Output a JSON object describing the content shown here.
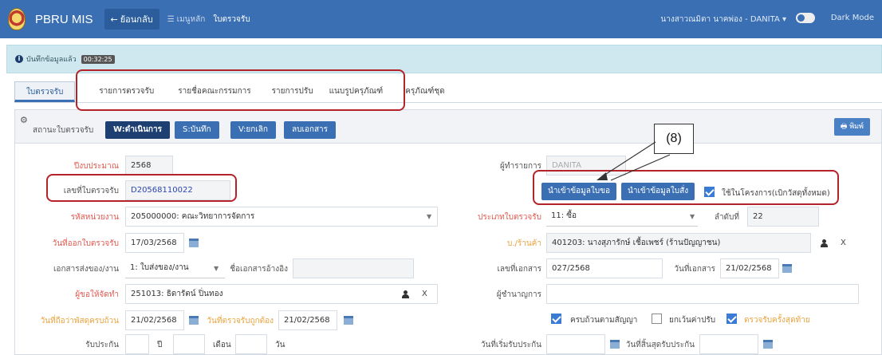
{
  "topbar": {
    "brand": "PBRU MIS",
    "back_label": "ย้อนกลับ",
    "menu_label": "เมนูหลัก",
    "crumb": "ใบตรวจรับ",
    "user": "นางสาวณมิตา นาคพ่อง - DANITA ▾",
    "dark_mode_label": "Dark Mode"
  },
  "alert": {
    "text": "บันทึกข้อมูลแล้ว",
    "time": "00:32:25"
  },
  "tabs": [
    {
      "label": "ใบตรวจรับ"
    },
    {
      "label": "รายการตรวจรับ"
    },
    {
      "label": "รายชื่อคณะกรรมการ"
    },
    {
      "label": "รายการปรับ"
    },
    {
      "label": "แนบรูปครุภัณฑ์"
    },
    {
      "label": "ครุภัณฑ์ชุด"
    }
  ],
  "status": {
    "label": "สถานะใบตรวจรับ",
    "buttons": [
      "W:ดำเนินการ",
      "S:บันทึก",
      "V:ยกเลิก",
      "ลบเอกสาร"
    ],
    "print_label": "พิมพ์"
  },
  "form": {
    "fiscal_year_label": "ปีงบประมาณ",
    "fiscal_year": "2568",
    "doc_no_label": "เลขที่ใบตรวจรับ",
    "doc_no": "D20568110022",
    "unit_label": "รหัสหน่วยงาน",
    "unit": "205000000: คณะวิทยาการจัดการ",
    "issue_date_label": "วันที่ออกใบตรวจรับ",
    "issue_date": "17/03/2568",
    "send_doc_label": "เอกสารส่งของ/งาน",
    "send_doc": "1: ใบส่งของ/งาน",
    "ref_doc_label": "ชื่อเอกสารอ้างอิง",
    "requester_label": "ผู้ขอให้จัดทำ",
    "requester": "251013: ธิดารัตน์ ปิ่นทอง",
    "deadline_label": "วันที่ถือว่าพัสดุครบถ้วน",
    "deadline": "21/02/2568",
    "correct_date_label": "วันที่ตรวจรับถูกต้อง",
    "correct_date": "21/02/2568",
    "warranty_label": "รับประกัน",
    "year_label": "ปี",
    "month_label": "เดือน",
    "day_label": "วัน",
    "operator_label": "ผู้ทำรายการ",
    "operator": "DANITA",
    "import_req_label": "นำเข้าข้อมูลใบขอ",
    "import_order_label": "นำเข้าข้อมูลใบสั่ง",
    "in_project_label": "ใช้ในโครงการ(เบิกวัสดุทั้งหมด)",
    "type_label": "ประเภทใบตรวจรับ",
    "type": "11: ซื้อ",
    "seq_label": "ลำดับที่",
    "seq": "22",
    "vendor_label": "บ./ร้านค้า",
    "vendor": "401203: นางสุภารักษ์ เชื้อเพชร์ (ร้านปัญญาชน)",
    "doc_number_label": "เลขที่เอกสาร",
    "doc_number": "027/2568",
    "doc_date_label": "วันที่เอกสาร",
    "doc_date": "21/02/2568",
    "expert_label": "ผู้ชำนาญการ",
    "complete_label": "ครบถ้วนตามสัญญา",
    "waive_label": "ยกเว้นค่าปรับ",
    "final_label": "ตรวจรับครั้งสุดท้าย",
    "warranty_start_label": "วันที่เริ่มรับประกัน",
    "warranty_end_label": "วันที่สิ้นสุดรับประกัน"
  },
  "annotation": {
    "callout": "(8)"
  }
}
